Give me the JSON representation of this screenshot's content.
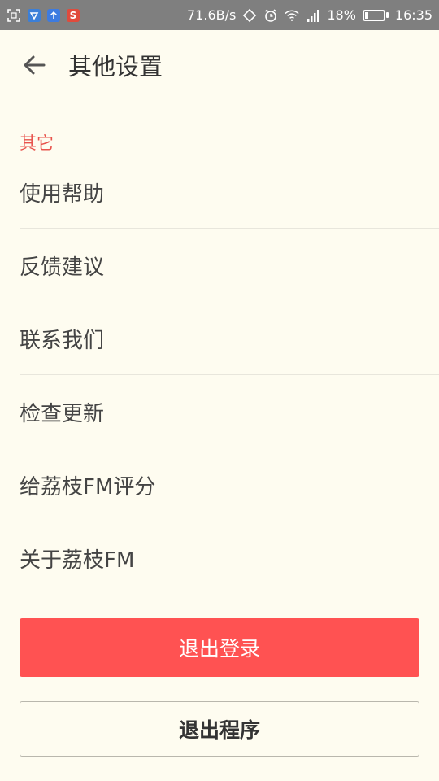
{
  "status_bar": {
    "network_speed": "71.6B/s",
    "battery": "18%",
    "battery_level": 0.18,
    "time": "16:35",
    "left_icons": [
      "screenshot-icon",
      "vpn-shield-icon",
      "upload-icon",
      "sogou-s-icon"
    ],
    "app_badge_text": "S",
    "colors": {
      "bar_bg": "#7f7f7f",
      "shield": "#3b7fd8",
      "upload": "#3d7be0",
      "sogou": "#e04b3c"
    }
  },
  "header": {
    "back_icon": "arrow-left-icon",
    "title": "其他设置"
  },
  "section": {
    "label": "其它"
  },
  "menu": {
    "items": [
      {
        "label": "使用帮助"
      },
      {
        "label": "反馈建议"
      },
      {
        "label": "联系我们"
      },
      {
        "label": "检查更新"
      },
      {
        "label": "给荔枝FM评分"
      },
      {
        "label": "关于荔枝FM"
      }
    ]
  },
  "buttons": {
    "logout_label": "退出登录",
    "exit_label": "退出程序"
  },
  "colors": {
    "background": "#fefcf0",
    "accent": "#ff5252",
    "section_label": "#e8534c"
  }
}
